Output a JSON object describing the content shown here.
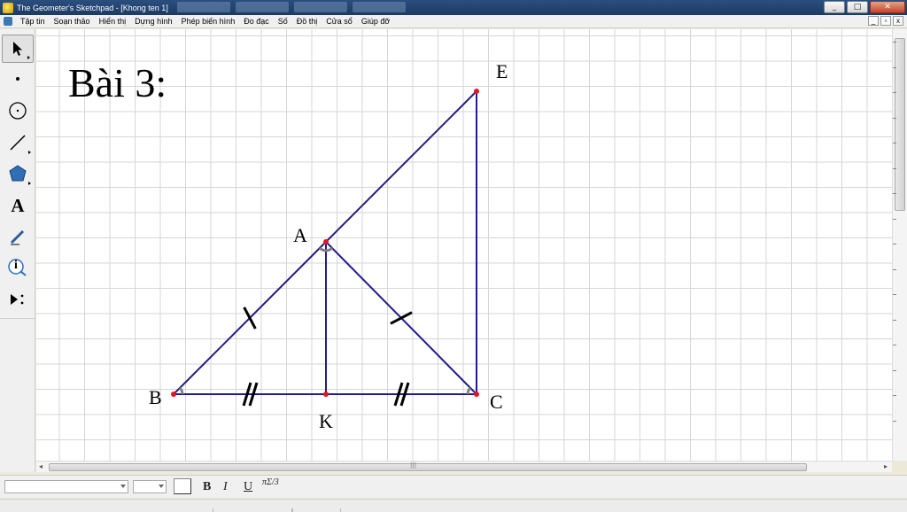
{
  "window": {
    "title": "The Geometer's Sketchpad - [Khong ten 1]",
    "buttons": {
      "minimize": "_",
      "maximize": "□",
      "close": "✕"
    }
  },
  "menu": {
    "items": [
      "Tập tin",
      "Soạn thảo",
      "Hiển thị",
      "Dựng hình",
      "Phép biến hình",
      "Đo đạc",
      "Số",
      "Đồ thị",
      "Cửa sổ",
      "Giúp đỡ"
    ],
    "mdi": {
      "minimize": "_",
      "restore": "▫",
      "close": "x"
    }
  },
  "toolbox": {
    "tools": [
      {
        "name": "selection-arrow-tool",
        "icon": "arrow-icon",
        "selected": true
      },
      {
        "name": "point-tool",
        "icon": "point-icon"
      },
      {
        "name": "compass-tool",
        "icon": "circle-icon"
      },
      {
        "name": "straightedge-tool",
        "icon": "line-icon"
      },
      {
        "name": "polygon-tool",
        "icon": "pentagon-icon"
      },
      {
        "name": "text-tool",
        "icon": "text-a-icon",
        "glyph": "A"
      },
      {
        "name": "marker-tool",
        "icon": "pen-icon"
      },
      {
        "name": "information-tool",
        "icon": "info-icon",
        "glyph": "i"
      },
      {
        "name": "custom-tool",
        "icon": "play-dots-icon"
      }
    ]
  },
  "canvas": {
    "heading": "Bài 3:",
    "labels": {
      "A": "A",
      "B": "B",
      "C": "C",
      "E": "E",
      "K": "K"
    },
    "colors": {
      "segment": "#1f1c8c",
      "point": "#e8141b",
      "tick": "#000000",
      "angle_mark": "#808080"
    }
  },
  "format_bar": {
    "bold": "B",
    "italic": "I",
    "underline": "U",
    "symbol_button": "πΣ/3"
  }
}
